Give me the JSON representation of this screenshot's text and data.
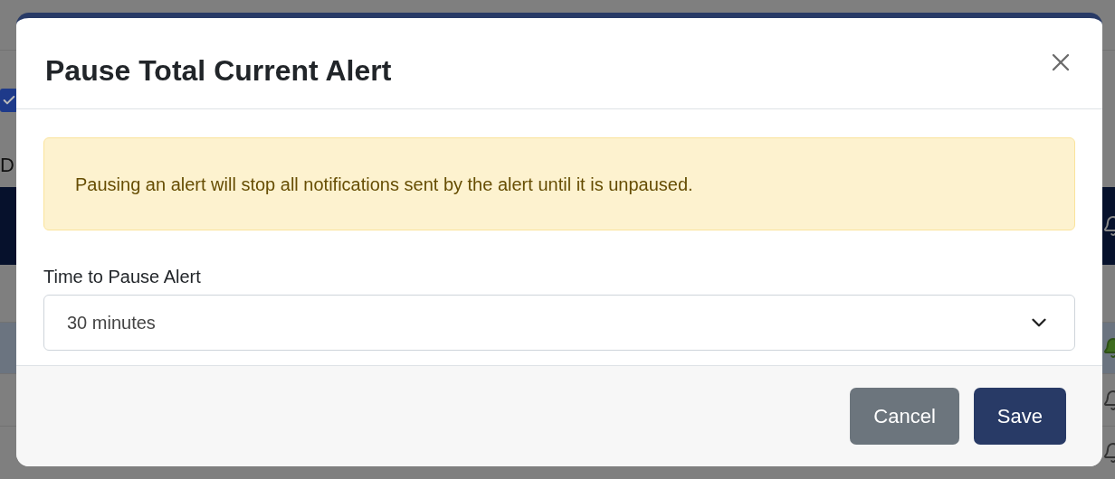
{
  "background": {
    "checkbox": {
      "checked": true
    },
    "text": "D"
  },
  "dialog": {
    "title": "Pause Total Current Alert",
    "alert": "Pausing an alert will stop all notifications sent by the alert until it is unpaused.",
    "field": {
      "label": "Time to Pause Alert",
      "value": "30 minutes"
    },
    "buttons": [
      {
        "label": "Cancel",
        "kind": "secondary"
      },
      {
        "label": "Save",
        "kind": "primary"
      }
    ]
  }
}
